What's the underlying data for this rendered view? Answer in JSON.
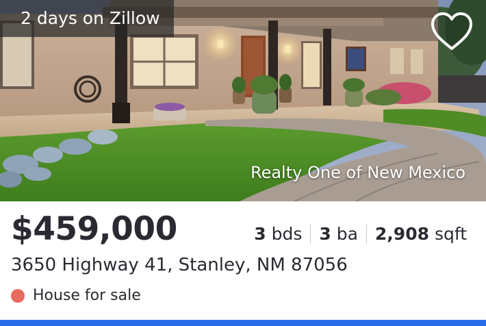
{
  "listing": {
    "days_badge": "2 days on Zillow",
    "favorite_icon": "heart-outline-icon",
    "photo_credit": "Realty One of New Mexico",
    "price": "$459,000",
    "beds_value": "3",
    "beds_unit": "bds",
    "baths_value": "3",
    "baths_unit": "ba",
    "sqft_value": "2,908",
    "sqft_unit": "sqft",
    "address": "3650 Highway 41, Stanley, NM 87056",
    "status_text": "House for sale",
    "status_color": "#e96b5d"
  },
  "theme": {
    "accent": "#2a6be8",
    "text": "#2a2a33"
  }
}
